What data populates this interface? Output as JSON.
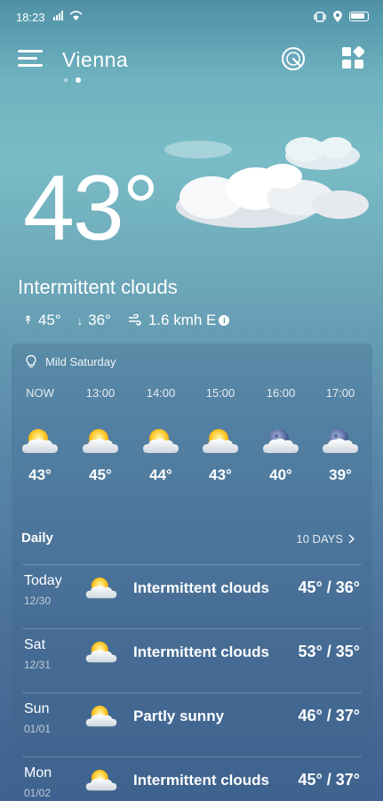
{
  "status": {
    "time": "18:23"
  },
  "header": {
    "city": "Vienna"
  },
  "current": {
    "temperature": "43°",
    "condition": "Intermittent clouds",
    "high": "45°",
    "low": "36°",
    "wind": "1.6 kmh E"
  },
  "hourly": {
    "summary": "Mild Saturday",
    "items": [
      {
        "time": "NOW",
        "temp": "43°",
        "icon": "partly-sunny-icon"
      },
      {
        "time": "13:00",
        "temp": "45°",
        "icon": "partly-sunny-icon"
      },
      {
        "time": "14:00",
        "temp": "44°",
        "icon": "partly-sunny-icon"
      },
      {
        "time": "15:00",
        "temp": "43°",
        "icon": "partly-sunny-icon"
      },
      {
        "time": "16:00",
        "temp": "40°",
        "icon": "cloudy-night-icon"
      },
      {
        "time": "17:00",
        "temp": "39°",
        "icon": "cloudy-night-icon"
      }
    ]
  },
  "daily": {
    "title": "Daily",
    "more_label": "10 DAYS",
    "items": [
      {
        "day": "Today",
        "date": "12/30",
        "condition": "Intermittent clouds",
        "range": "45° / 36°"
      },
      {
        "day": "Sat",
        "date": "12/31",
        "condition": "Intermittent clouds",
        "range": "53° / 35°"
      },
      {
        "day": "Sun",
        "date": "01/01",
        "condition": "Partly sunny",
        "range": "46° / 37°"
      },
      {
        "day": "Mon",
        "date": "01/02",
        "condition": "Intermittent clouds",
        "range": "45° / 37°"
      }
    ]
  }
}
